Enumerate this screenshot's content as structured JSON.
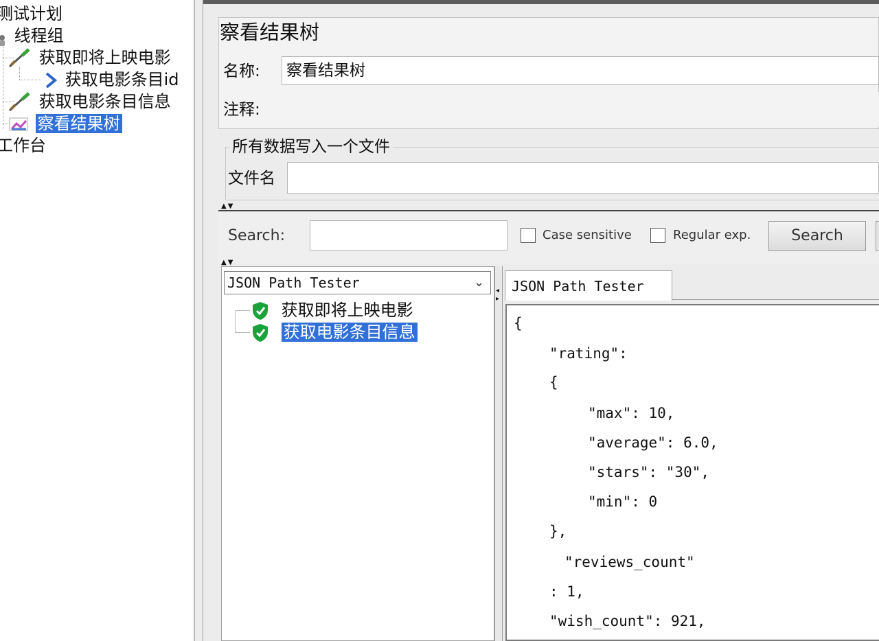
{
  "tree": {
    "items": [
      {
        "label": "测试计划"
      },
      {
        "label": "线程组"
      },
      {
        "label": "获取即将上映电影"
      },
      {
        "label": "获取电影条目id"
      },
      {
        "label": "获取电影条目信息"
      },
      {
        "label": "察看结果树",
        "selected": true
      },
      {
        "label": "工作台"
      }
    ]
  },
  "panel": {
    "title": "察看结果树",
    "name_label": "名称:",
    "name_value": "察看结果树",
    "comment_label": "注释:",
    "comment_value": "",
    "fieldset_legend": "所有数据写入一个文件",
    "filename_label": "文件名",
    "filename_value": ""
  },
  "search": {
    "label": "Search:",
    "value": "",
    "case_sensitive_label": "Case sensitive",
    "case_sensitive_checked": false,
    "regex_label": "Regular exp.",
    "regex_checked": false,
    "button_label": "Search"
  },
  "results": {
    "renderer": "JSON Path Tester",
    "samples": [
      {
        "label": "获取即将上映电影",
        "status": "success"
      },
      {
        "label": "获取电影条目信息",
        "status": "success",
        "selected": true
      }
    ]
  },
  "viewer": {
    "tab_label": "JSON Path Tester",
    "json_lines": [
      "{",
      "\"rating\":",
      "{",
      "\"max\": 10,",
      "\"average\": 6.0,",
      "\"stars\": \"30\",",
      "\"min\": 0",
      "},",
      "\"reviews_count\"",
      ": 1,",
      "\"wish_count\": 921,"
    ]
  },
  "colors": {
    "selection": "#3070d8",
    "success_icon": "#1aa33a"
  },
  "icons": [
    "sampler-dropper-icon",
    "arrow-right-icon",
    "results-tree-icon",
    "thread-group-icon",
    "success-shield-icon",
    "chevron-down-icon"
  ]
}
